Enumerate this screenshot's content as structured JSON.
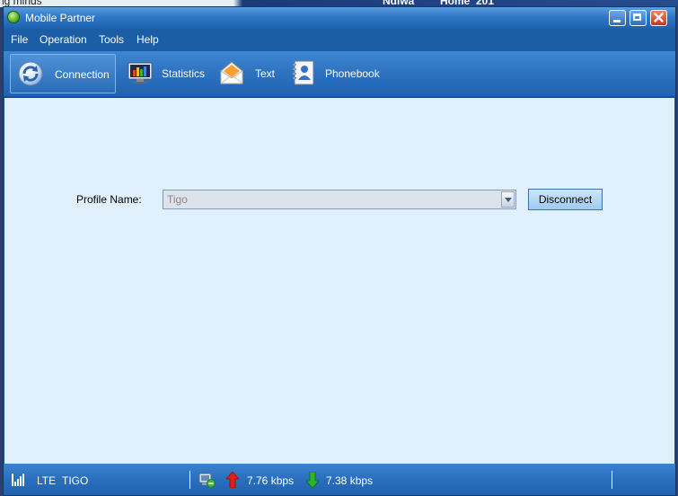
{
  "background_window": {
    "partial_texts": [
      "ig minds",
      "Ndiwa",
      "Home",
      "201"
    ]
  },
  "window": {
    "title": "Mobile Partner",
    "icon": "mobile-partner-logo-icon"
  },
  "menu": {
    "items": [
      "File",
      "Operation",
      "Tools",
      "Help"
    ]
  },
  "toolbar": {
    "items": [
      {
        "label": "Connection",
        "icon": "connection-refresh-icon",
        "active": true
      },
      {
        "label": "Statistics",
        "icon": "statistics-monitor-icon",
        "active": false
      },
      {
        "label": "Text",
        "icon": "envelope-icon",
        "active": false
      },
      {
        "label": "Phonebook",
        "icon": "phonebook-contact-icon",
        "active": false
      }
    ]
  },
  "connection": {
    "profile_label": "Profile Name:",
    "profile_value": "Tigo",
    "disconnect_label": "Disconnect"
  },
  "status": {
    "network_type": "LTE",
    "operator": "TIGO",
    "upload_rate": "7.76 kbps",
    "download_rate": "7.38 kbps"
  },
  "colors": {
    "title_bar": "#2f78c6",
    "toolbar": "#2c72c0",
    "content_bg": "#e0f0fc",
    "upload_arrow": "#e02010",
    "download_arrow": "#2fb52a"
  }
}
